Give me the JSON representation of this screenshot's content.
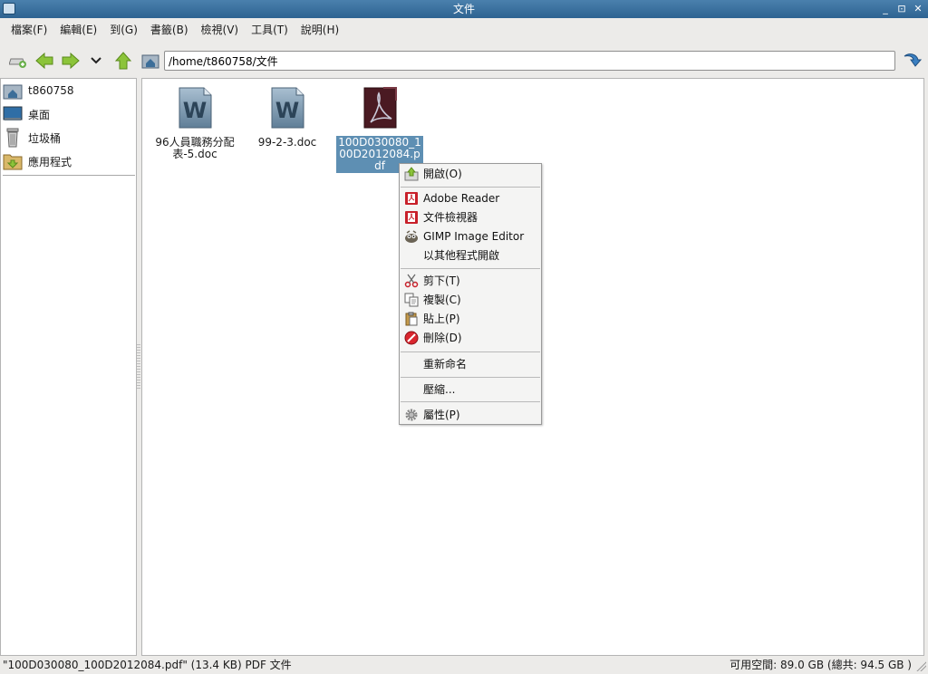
{
  "window": {
    "title": "文件",
    "controls": [
      "_",
      "⊡",
      "✕"
    ]
  },
  "menubar": {
    "items": [
      {
        "name": "file",
        "label": "檔案(F)"
      },
      {
        "name": "edit",
        "label": "編輯(E)"
      },
      {
        "name": "go",
        "label": "到(G)"
      },
      {
        "name": "bookmarks",
        "label": "書籤(B)"
      },
      {
        "name": "view",
        "label": "檢視(V)"
      },
      {
        "name": "tools",
        "label": "工具(T)"
      },
      {
        "name": "help",
        "label": "說明(H)"
      }
    ]
  },
  "toolbar": {
    "location": "/home/t860758/文件"
  },
  "sidepane": {
    "places": [
      {
        "name": "home",
        "label": "t860758",
        "icon": "home-folder-icon"
      },
      {
        "name": "desktop",
        "label": "桌面",
        "icon": "desktop-icon"
      },
      {
        "name": "trash",
        "label": "垃圾桶",
        "icon": "trash-icon"
      },
      {
        "name": "applications",
        "label": "應用程式",
        "icon": "applications-folder-icon"
      }
    ]
  },
  "files": [
    {
      "name": "96人員職務分配表-5.doc",
      "type": "word-document",
      "selected": false
    },
    {
      "name": "99-2-3.doc",
      "type": "word-document",
      "selected": false
    },
    {
      "name": "100D030080_100D2012084.pdf",
      "type": "pdf-document",
      "selected": true
    }
  ],
  "context_menu": {
    "open": "開啟(O)",
    "adobe_reader": "Adobe Reader",
    "document_viewer": "文件檢視器",
    "gimp": "GIMP Image Editor",
    "open_with_other": "以其他程式開啟",
    "cut": "剪下(T)",
    "copy": "複製(C)",
    "paste": "貼上(P)",
    "delete": "刪除(D)",
    "rename": "重新命名",
    "compress": "壓縮...",
    "properties": "屬性(P)"
  },
  "statusbar": {
    "left": "\"100D030080_100D2012084.pdf\" (13.4 KB) PDF 文件",
    "right": "可用空間: 89.0 GB (總共: 94.5 GB )"
  },
  "colors": {
    "titlebar": "#2e6391",
    "selection": "#5e8fb3",
    "arrow_green": "#8cc43a"
  }
}
